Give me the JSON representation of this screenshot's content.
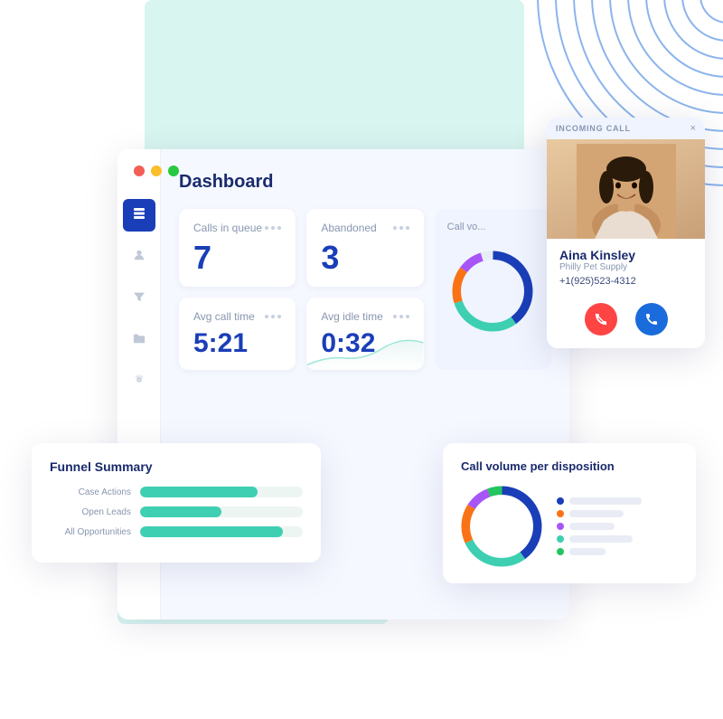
{
  "app": {
    "title": "Dashboard"
  },
  "traffic_lights": {
    "red": "#f25f57",
    "yellow": "#f9be2a",
    "green": "#28c840"
  },
  "sidebar": {
    "items": [
      {
        "id": "layers",
        "icon": "⊞",
        "active": true
      },
      {
        "id": "user",
        "icon": "👤",
        "active": false
      },
      {
        "id": "filter",
        "icon": "▽",
        "active": false
      },
      {
        "id": "folder",
        "icon": "📁",
        "active": false
      },
      {
        "id": "settings",
        "icon": "⚙",
        "active": false
      }
    ]
  },
  "metrics": [
    {
      "id": "calls_in_queue",
      "label": "Calls in queue",
      "value": "7"
    },
    {
      "id": "abandoned",
      "label": "Abandoned",
      "value": "3"
    },
    {
      "id": "avg_call_time",
      "label": "Avg call time",
      "value": "5:21"
    },
    {
      "id": "avg_idle_time",
      "label": "Avg idle time",
      "value": "0:32"
    }
  ],
  "funnel": {
    "title": "Funnel Summary",
    "rows": [
      {
        "label": "Case Actions",
        "pct": 72
      },
      {
        "label": "Open Leads",
        "pct": 50
      },
      {
        "label": "All Opportunities",
        "pct": 88
      }
    ]
  },
  "disposition": {
    "title": "Call volume per disposition",
    "legend": [
      {
        "color": "#1a3eb8"
      },
      {
        "color": "#f97316"
      },
      {
        "color": "#a855f7"
      },
      {
        "color": "#3ecfb2"
      },
      {
        "color": "#22c55e"
      }
    ]
  },
  "incoming_call": {
    "header": "INCOMING CALL",
    "close_label": "×",
    "caller_name": "Aina Kinsley",
    "caller_company": "Philly Pet Supply",
    "caller_phone": "+1(925)523-4312",
    "decline_label": "📵",
    "accept_label": "📞"
  }
}
